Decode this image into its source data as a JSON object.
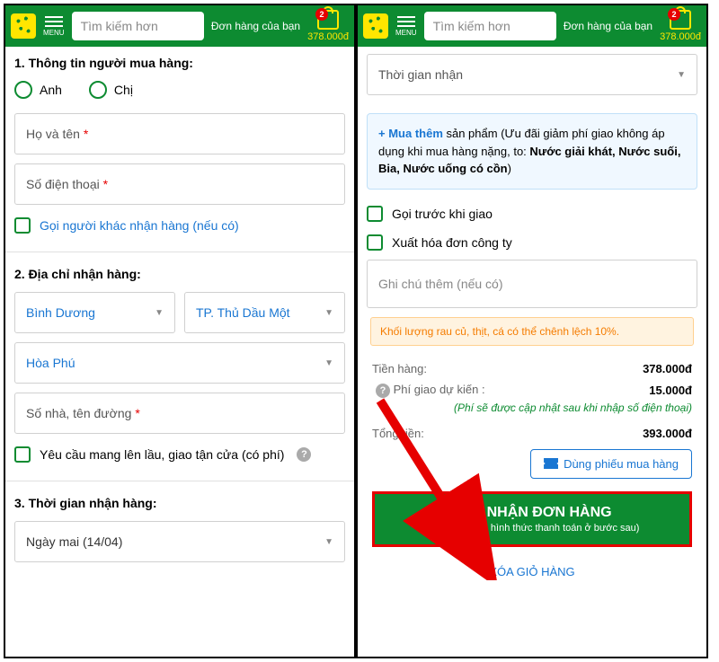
{
  "header": {
    "menu_label": "MENU",
    "search_placeholder": "Tìm kiếm hơn",
    "order_link": "Đơn hàng của bạn",
    "cart_badge": "2",
    "cart_total": "378.000đ"
  },
  "left": {
    "section1_title": "1. Thông tin người mua hàng:",
    "radio_anh": "Anh",
    "radio_chi": "Chị",
    "name_placeholder": "Họ và tên",
    "phone_placeholder": "Số điện thoại",
    "other_recipient": "Gọi người khác nhận hàng (nếu có)",
    "section2_title": "2. Địa chỉ nhận hàng:",
    "province": "Bình Dương",
    "city": "TP. Thủ Dầu Một",
    "ward": "Hòa Phú",
    "street_placeholder": "Số nhà, tên đường",
    "stairs_option": "Yêu cầu mang lên lầu, giao tận cửa (có phí)",
    "section3_title": "3. Thời gian nhận hàng:",
    "date_option": "Ngày mai (14/04)"
  },
  "right": {
    "time_placeholder": "Thời gian nhận",
    "promo_plus": "+ Mua thêm",
    "promo_text1": " sản phẩm (Ưu đãi giảm phí giao không áp dụng khi mua hàng nặng, to: ",
    "promo_bold": "Nước giải khát, Nước suối, Bia, Nước uống có cồn",
    "promo_close": ")",
    "call_before": "Gọi trước khi giao",
    "invoice": "Xuất hóa đơn công ty",
    "note_placeholder": "Ghi chú thêm (nếu có)",
    "warning": "Khối lượng rau củ, thịt, cá có thể chênh lệch 10%.",
    "goods_label": "Tiền hàng:",
    "goods_value": "378.000đ",
    "ship_label": "Phí giao dự kiến :",
    "ship_value": "15.000đ",
    "ship_note": "(Phí sẽ được cập nhật sau khi nhập số điện thoại)",
    "total_label": "Tổng tiền:",
    "total_value": "393.000đ",
    "voucher": "Dùng phiếu mua hàng",
    "confirm_main": "XÁC NHẬN ĐƠN HÀNG",
    "confirm_sub": "(Lựa chọn các hình thức thanh toán ở bước sau)",
    "clear_cart": "XÓA GIỎ HÀNG"
  }
}
